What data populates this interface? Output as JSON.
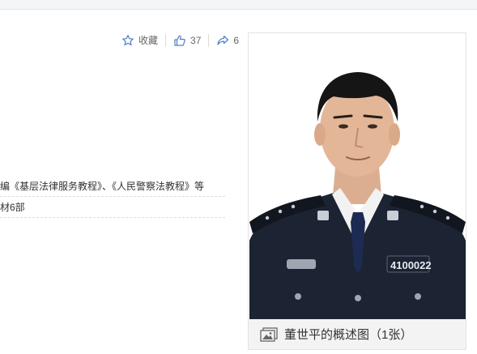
{
  "actions": {
    "favorite_label": "收藏",
    "like_count": "37",
    "share_count": "6"
  },
  "content": {
    "line1": "编《基层法律服务教程》、《人民警察法教程》等",
    "line2": "材6部"
  },
  "album": {
    "caption": "董世平的概述图（1张）",
    "photo_badge_number": "4100022"
  },
  "colors": {
    "icon_blue": "#4f7fc6",
    "uniform": "#1c2333",
    "caption_bg": "#f3f3f3"
  }
}
